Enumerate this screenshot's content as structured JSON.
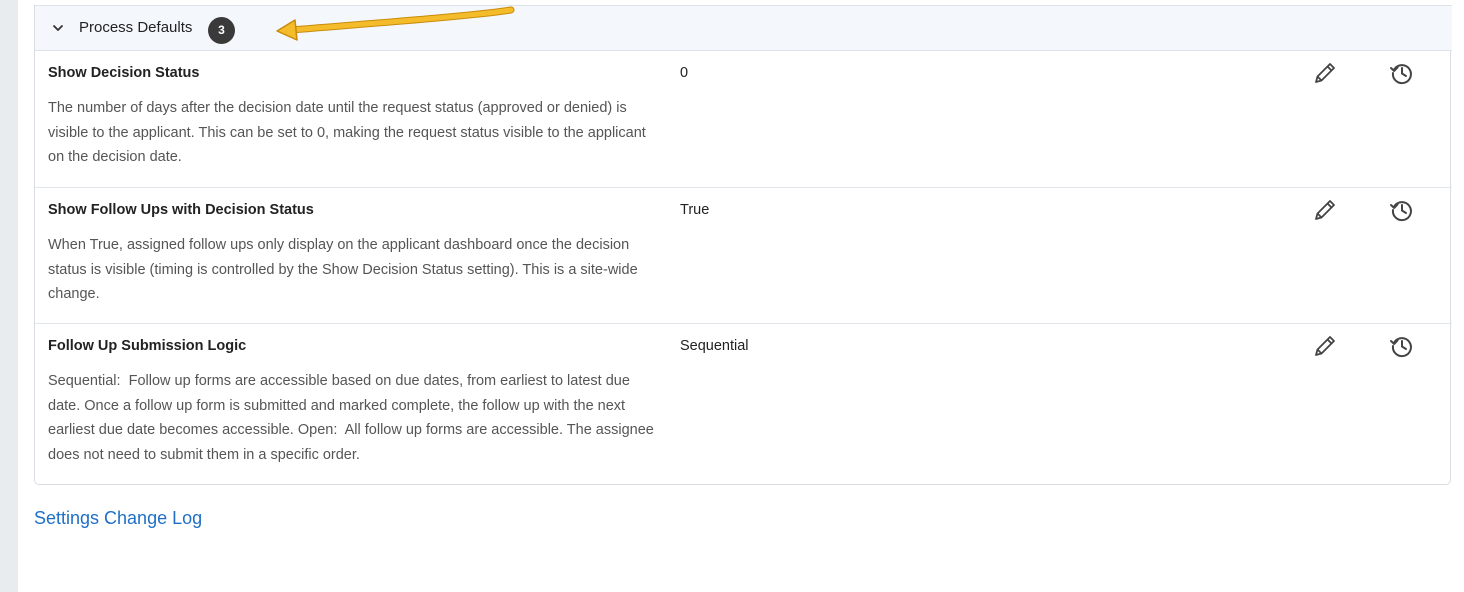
{
  "section": {
    "title": "Process Defaults",
    "count": "3",
    "icons": {
      "toggle": "chevron-down-icon",
      "edit": "pencil-icon",
      "history": "history-icon"
    }
  },
  "settings": [
    {
      "name": "Show Decision Status",
      "description": "The number of days after the decision date until the request status (approved or denied) is visible to the applicant. This can be set to 0, making the request status visible to the applicant on the decision date.",
      "value": "0"
    },
    {
      "name": "Show Follow Ups with Decision Status",
      "description": "When True, assigned follow ups only display on the applicant dashboard once the decision status is visible (timing is controlled by the Show Decision Status setting). This is a site-wide change.",
      "value": "True"
    },
    {
      "name": "Follow Up Submission Logic",
      "description": "Sequential:  Follow up forms are accessible based on due dates, from earliest to latest due date. Once a follow up form is submitted and marked complete, the follow up with the next earliest due date becomes accessible. Open:  All follow up forms are accessible. The assignee does not need to submit them in a specific order.",
      "value": "Sequential"
    }
  ],
  "footer": {
    "change_log_link": "Settings Change Log"
  },
  "colors": {
    "header_bg": "#f4f8fd",
    "badge_bg": "#3a3a3a",
    "link": "#1f6fc5",
    "annotation_arrow": "#f0b323"
  }
}
